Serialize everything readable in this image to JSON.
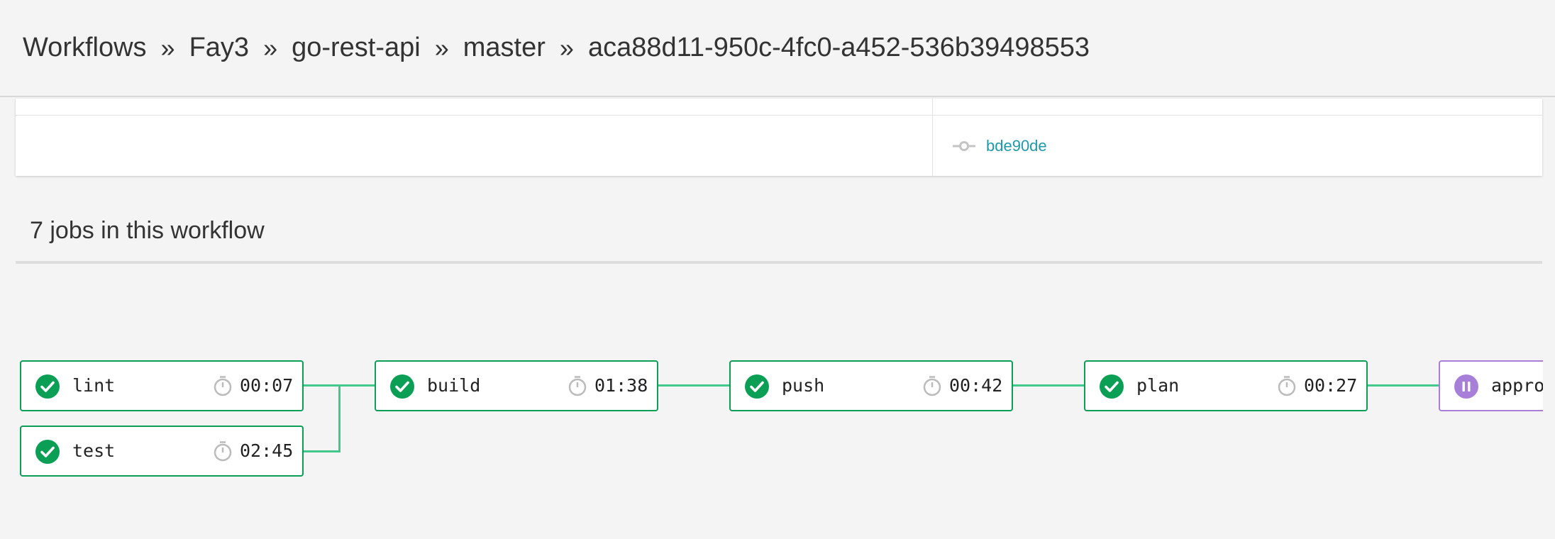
{
  "breadcrumb": {
    "items": [
      "Workflows",
      "Fay3",
      "go-rest-api",
      "master",
      "aca88d11-950c-4fc0-a452-536b39498553"
    ],
    "separator": "»"
  },
  "summary": {
    "commit": "bde90de"
  },
  "jobs_section": {
    "heading": "7 jobs in this workflow"
  },
  "jobs": [
    {
      "name": "lint",
      "duration": "00:07",
      "status": "success"
    },
    {
      "name": "test",
      "duration": "02:45",
      "status": "success"
    },
    {
      "name": "build",
      "duration": "01:38",
      "status": "success"
    },
    {
      "name": "push",
      "duration": "00:42",
      "status": "success"
    },
    {
      "name": "plan",
      "duration": "00:27",
      "status": "success"
    },
    {
      "name": "appro",
      "status": "on-hold"
    }
  ],
  "colors": {
    "success": "#0a9f55",
    "connector": "#42c88a",
    "on_hold": "#a77fd8",
    "link": "#1f9aaa"
  },
  "icons": {
    "success": "check-circle-icon",
    "on_hold": "pause-circle-icon",
    "timer": "stopwatch-icon",
    "commit": "git-commit-icon"
  }
}
